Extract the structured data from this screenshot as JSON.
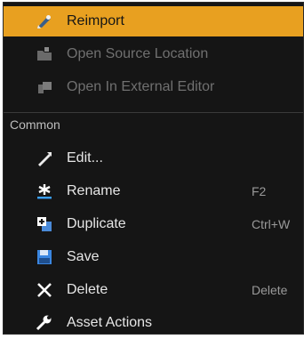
{
  "menu": {
    "items_top": [
      {
        "label": "Reimport",
        "icon": "reimport-icon",
        "state": "highlighted"
      },
      {
        "label": "Open Source Location",
        "icon": "folder-icon",
        "state": "disabled"
      },
      {
        "label": "Open In External Editor",
        "icon": "external-editor-icon",
        "state": "disabled"
      }
    ],
    "section_label": "Common",
    "items_common": [
      {
        "label": "Edit...",
        "icon": "edit-icon",
        "shortcut": ""
      },
      {
        "label": "Rename",
        "icon": "rename-icon",
        "shortcut": "F2"
      },
      {
        "label": "Duplicate",
        "icon": "duplicate-icon",
        "shortcut": "Ctrl+W"
      },
      {
        "label": "Save",
        "icon": "save-icon",
        "shortcut": ""
      },
      {
        "label": "Delete",
        "icon": "delete-icon",
        "shortcut": "Delete"
      },
      {
        "label": "Asset Actions",
        "icon": "wrench-icon",
        "shortcut": ""
      }
    ]
  },
  "colors": {
    "menu_bg": "#151515",
    "highlight": "#e8a020",
    "text": "#e6e6e6",
    "disabled_text": "#707070",
    "shortcut_text": "#9a9a9a"
  }
}
